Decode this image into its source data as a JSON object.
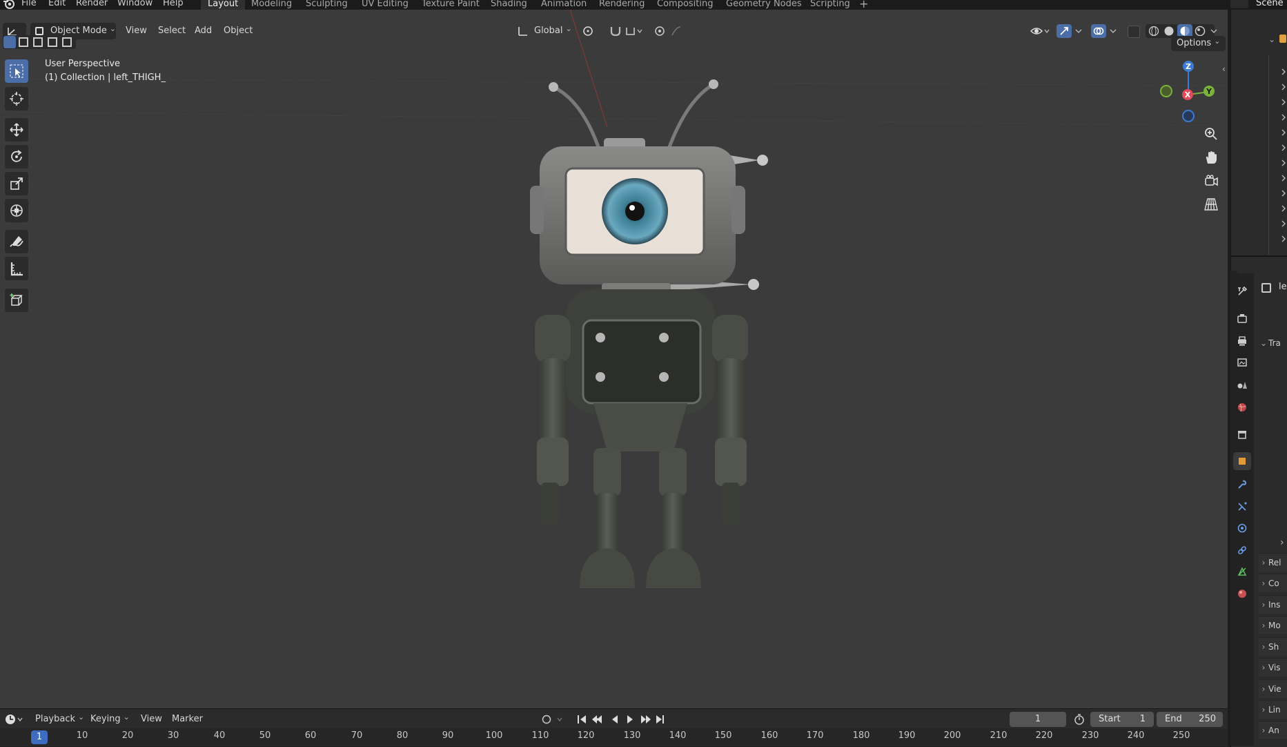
{
  "menubar": {
    "items": [
      "File",
      "Edit",
      "Render",
      "Window",
      "Help"
    ],
    "scene": "Scene"
  },
  "workspaces": {
    "tabs": [
      "Layout",
      "Modeling",
      "Sculpting",
      "UV Editing",
      "Texture Paint",
      "Shading",
      "Animation",
      "Rendering",
      "Compositing",
      "Geometry Nodes",
      "Scripting"
    ],
    "active": "Layout",
    "add_symbol": "+"
  },
  "viewport_header": {
    "mode": "Object Mode",
    "menus": [
      "View",
      "Select",
      "Add",
      "Object"
    ],
    "transform_orientation": "Global",
    "options_label": "Options"
  },
  "viewport": {
    "perspective_label": "User Perspective",
    "collection_label": "(1) Collection | left_THIGH_",
    "gizmo": {
      "z": "Z",
      "x": "X",
      "y": "Y"
    },
    "colors": {
      "background": "#3b3b3b",
      "accent": "#4c6ea8"
    }
  },
  "toolbar": {
    "tools": [
      "select-box",
      "cursor",
      "move",
      "rotate",
      "scale",
      "transform",
      "annotate",
      "measure",
      "add-cube"
    ],
    "active": "select-box"
  },
  "properties": {
    "object_name_partial": "le",
    "sections": [
      "Tra",
      "Rel",
      "Co",
      "Ins",
      "Mo",
      "Sh",
      "Vis",
      "Vie",
      "Lin",
      "An"
    ]
  },
  "timeline": {
    "menus": [
      "Playback",
      "Keying",
      "View",
      "Marker"
    ],
    "current_frame": "1",
    "start_label": "Start",
    "start_value": "1",
    "end_label": "End",
    "end_value": "250",
    "ruler": [
      "10",
      "20",
      "30",
      "40",
      "50",
      "60",
      "70",
      "80",
      "90",
      "100",
      "110",
      "120",
      "130",
      "140",
      "150",
      "160",
      "170",
      "180",
      "190",
      "200",
      "210",
      "220",
      "230",
      "240",
      "250"
    ],
    "ruler_current": "1"
  }
}
